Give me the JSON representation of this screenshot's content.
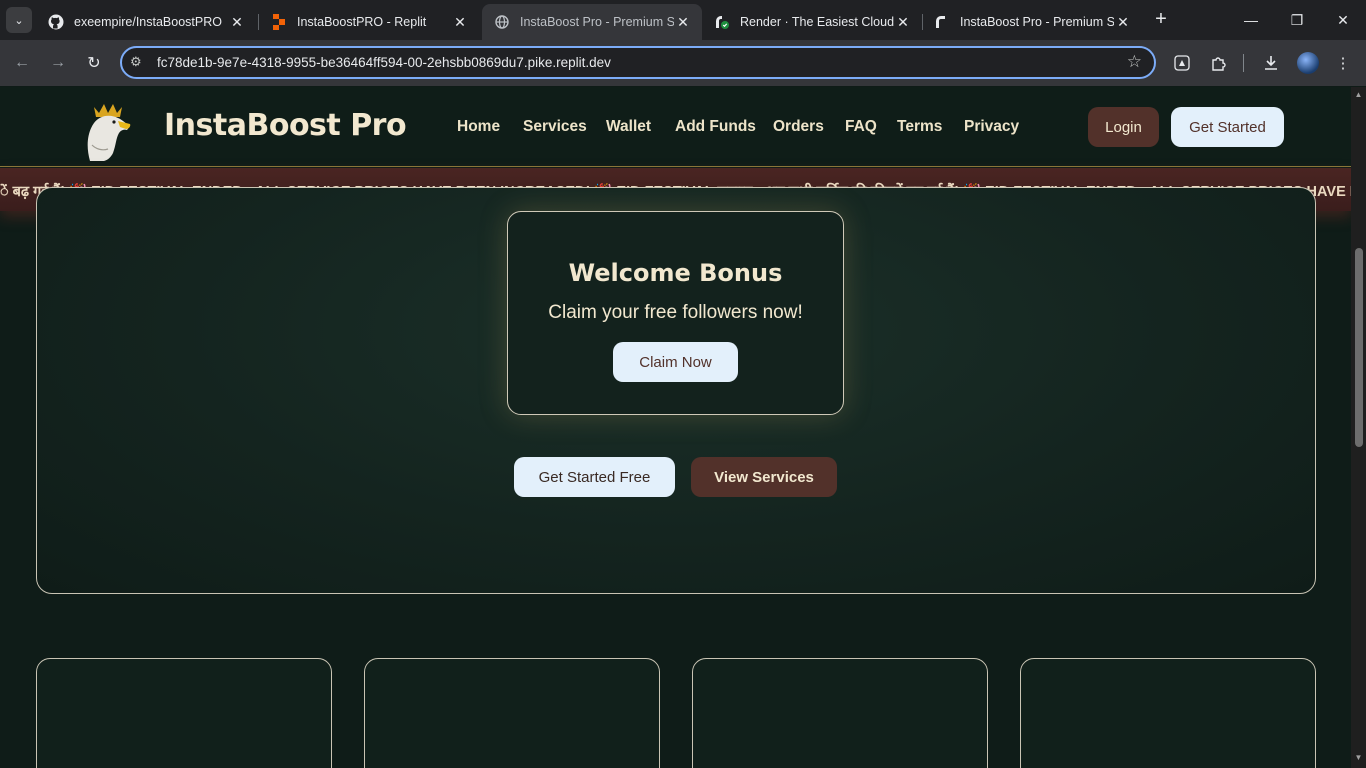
{
  "browser": {
    "tabs": [
      {
        "title": "exeempire/InstaBoostPRO",
        "icon": "github-icon",
        "active": false
      },
      {
        "title": "InstaBoostPRO - Replit",
        "icon": "replit-icon",
        "active": false
      },
      {
        "title": "InstaBoost Pro - Premium SMM",
        "icon": "globe-icon",
        "active": true
      },
      {
        "title": "Render · The Easiest Cloud For",
        "icon": "render-icon",
        "active": false
      },
      {
        "title": "InstaBoost Pro - Premium SMM",
        "icon": "render-icon",
        "active": false
      }
    ],
    "url": "fc78de1b-9e7e-4318-9955-be36464ff594-00-2ehsbb0869du7.pike.replit.dev"
  },
  "site": {
    "brand": "InstaBoost Pro",
    "nav": [
      "Home",
      "Services",
      "Wallet",
      "Add Funds",
      "Orders",
      "FAQ",
      "Terms",
      "Privacy"
    ],
    "login_label": "Login",
    "get_started_label": "Get Started",
    "ticker": "ें बढ़ गई हैं! 🎉 EID FESTIVAL ENDED - ALL SERVICE PRICES HAVE BEEN INCREASED! 🎉 EID FESTIVAL समाप्त - अब सभी सर्विस की कीमतें बढ़ गई हैं! 🎉 EID FESTIVAL ENDED - ALL SERVICE PRICES HAVE BEEN INCREASED!",
    "bonus": {
      "title": "Welcome Bonus",
      "subtitle": "Claim your free followers now!",
      "button": "Claim Now"
    },
    "hero_buttons": {
      "primary": "Get Started Free",
      "secondary": "View Services"
    },
    "colors": {
      "background": "#0f1c18",
      "cream": "#f2e8cf",
      "brown": "#52312a",
      "light_blue": "#e3f0fb",
      "ticker": "#4a2522"
    }
  }
}
